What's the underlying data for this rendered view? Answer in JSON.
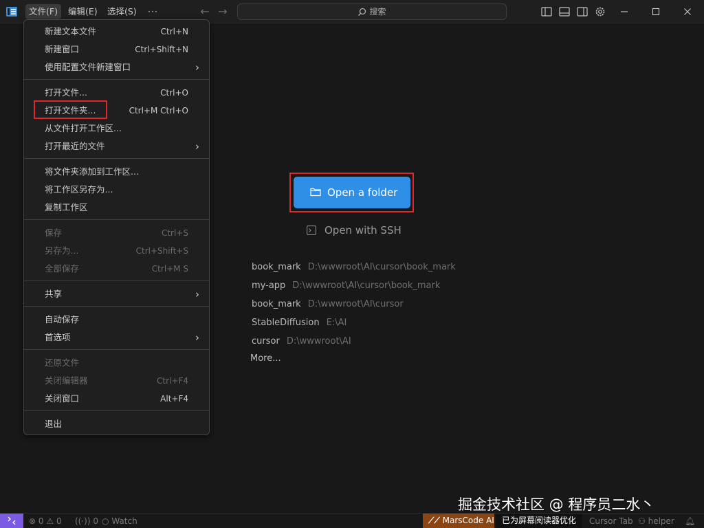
{
  "titlebar": {
    "menus": [
      "文件(F)",
      "编辑(E)",
      "选择(S)"
    ],
    "more": "···",
    "search_placeholder": "搜索"
  },
  "file_menu": {
    "groups": [
      [
        {
          "label": "新建文本文件",
          "shortcut": "Ctrl+N"
        },
        {
          "label": "新建窗口",
          "shortcut": "Ctrl+Shift+N"
        },
        {
          "label": "使用配置文件新建窗口",
          "submenu": "›"
        }
      ],
      [
        {
          "label": "打开文件...",
          "shortcut": "Ctrl+O"
        },
        {
          "label": "打开文件夹...",
          "shortcut": "Ctrl+M Ctrl+O"
        },
        {
          "label": "从文件打开工作区..."
        },
        {
          "label": "打开最近的文件",
          "submenu": "›"
        }
      ],
      [
        {
          "label": "将文件夹添加到工作区..."
        },
        {
          "label": "将工作区另存为..."
        },
        {
          "label": "复制工作区"
        }
      ],
      [
        {
          "label": "保存",
          "shortcut": "Ctrl+S",
          "disabled": true
        },
        {
          "label": "另存为...",
          "shortcut": "Ctrl+Shift+S",
          "disabled": true
        },
        {
          "label": "全部保存",
          "shortcut": "Ctrl+M S",
          "disabled": true
        }
      ],
      [
        {
          "label": "共享",
          "submenu": "›"
        }
      ],
      [
        {
          "label": "自动保存"
        },
        {
          "label": "首选项",
          "submenu": "›"
        }
      ],
      [
        {
          "label": "还原文件",
          "disabled": true
        },
        {
          "label": "关闭编辑器",
          "shortcut": "Ctrl+F4",
          "disabled": true
        },
        {
          "label": "关闭窗口",
          "shortcut": "Alt+F4"
        }
      ],
      [
        {
          "label": "退出"
        }
      ]
    ]
  },
  "welcome": {
    "open_folder": "Open a folder",
    "open_ssh": "Open with SSH",
    "recent": [
      {
        "name": "book_mark",
        "path": "D:\\wwwroot\\AI\\cursor\\book_mark"
      },
      {
        "name": "my-app",
        "path": "D:\\wwwroot\\AI\\cursor\\book_mark"
      },
      {
        "name": "book_mark",
        "path": "D:\\wwwroot\\AI\\cursor"
      },
      {
        "name": "StableDiffusion",
        "path": "E:\\AI"
      },
      {
        "name": "cursor",
        "path": "D:\\wwwroot\\AI"
      }
    ],
    "more": "More..."
  },
  "statusbar": {
    "errors": "0",
    "warnings": "0",
    "ports": "0",
    "watch": "Watch",
    "marscode": "MarsCode AI",
    "screen_reader": "已为屏幕阅读器优化",
    "cursor_tab": "Cursor Tab",
    "helper": "helper"
  },
  "watermark": "掘金技术社区 @ 程序员二水丶",
  "colors": {
    "background": "#181818",
    "accent_button": "#2f8fe6",
    "highlight_box": "#e0262b",
    "remote_button": "#7b5be3",
    "marscode_badge": "#8b4513"
  }
}
